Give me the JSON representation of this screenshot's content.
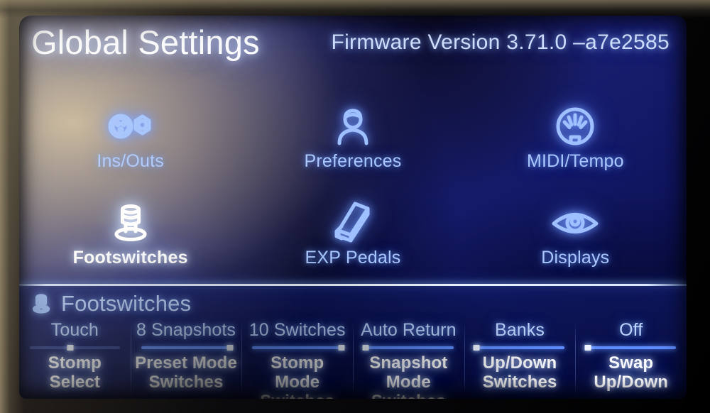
{
  "header": {
    "title": "Global Settings",
    "firmware": "Firmware Version 3.71.0 –a7e2585"
  },
  "menu": {
    "items": [
      {
        "label": "Ins/Outs",
        "icon": "xlr-jack-icon",
        "selected": false
      },
      {
        "label": "Preferences",
        "icon": "user-person-icon",
        "selected": false
      },
      {
        "label": "MIDI/Tempo",
        "icon": "midi-din-icon",
        "selected": false
      },
      {
        "label": "Footswitches",
        "icon": "footswitch-icon",
        "selected": true
      },
      {
        "label": "EXP Pedals",
        "icon": "expression-pedal-icon",
        "selected": false
      },
      {
        "label": "Displays",
        "icon": "eye-icon",
        "selected": false
      }
    ]
  },
  "footer": {
    "section_icon": "footswitch-icon",
    "section_title": "Footswitches",
    "params": [
      {
        "value": "Touch",
        "name": "Stomp Select",
        "fill": "dim",
        "thumb_pct": 45
      },
      {
        "value": "8 Snapshots",
        "name": "Preset Mode\nSwitches",
        "fill": "bright",
        "thumb_pct": 100
      },
      {
        "value": "10 Switches",
        "name": "Stomp Mode\nSwitches",
        "fill": "bright",
        "thumb_pct": 100
      },
      {
        "value": "Auto Return",
        "name": "Snapshot Mode\nSwitches",
        "fill": "bright",
        "thumb_pct": 1
      },
      {
        "value": "Banks",
        "name": "Up/Down\nSwitches",
        "fill": "bright",
        "thumb_pct": 1
      },
      {
        "value": "Off",
        "name": "Swap\nUp/Down",
        "fill": "bright",
        "thumb_pct": 1
      }
    ]
  },
  "colors": {
    "screen_blue": "#1b2070",
    "glow_blue": "#9fc0ff",
    "selected_white": "#ffffff",
    "divider": "#e8f0ff"
  }
}
